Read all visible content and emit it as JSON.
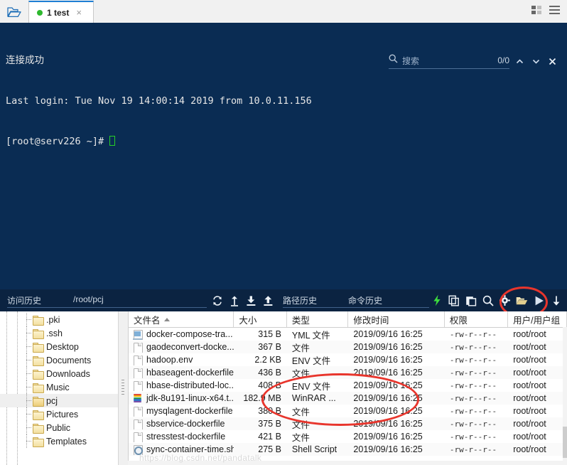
{
  "window": {
    "tab_icon": "folder-open-icon",
    "tabs": [
      {
        "label": "1 test",
        "status_dot": "connected",
        "close": "×"
      }
    ],
    "right_icons": [
      "grid-view-icon",
      "list-view-icon"
    ]
  },
  "terminal": {
    "line1": "连接成功",
    "line2": "Last login: Tue Nov 19 14:00:14 2019 from 10.0.11.156",
    "line3": "[root@serv226 ~]# ",
    "background_color": "#0a2c53",
    "text_color": "#e6e6e6",
    "cursor_color": "#27d027"
  },
  "search": {
    "icon": "search-icon",
    "placeholder": "搜索",
    "value": "",
    "count": "0/0",
    "prev_icon": "chevron-up-icon",
    "next_icon": "chevron-down-icon",
    "close_icon": "close-icon"
  },
  "toolbar": {
    "visit_history_label": "访问历史",
    "path_value": "/root/pcj",
    "path_history_label": "路径历史",
    "command_history_label": "命令历史",
    "left_icons": [
      "refresh-icon",
      "parent-folder-icon",
      "download-icon",
      "upload-icon"
    ],
    "right_icons": [
      "lightning-icon",
      "copy-icon",
      "paste-icon",
      "search-icon",
      "gear-icon",
      "open-folder-icon",
      "run-icon",
      "save-icon",
      "window-icon"
    ],
    "accent_color": "#2eb82e",
    "annotation_color": "#e8352c"
  },
  "tree": {
    "items": [
      {
        "label": ".pki",
        "icon": "folder-icon",
        "selected": false
      },
      {
        "label": ".ssh",
        "icon": "folder-icon",
        "selected": false
      },
      {
        "label": "Desktop",
        "icon": "folder-icon",
        "selected": false
      },
      {
        "label": "Documents",
        "icon": "folder-icon",
        "selected": false
      },
      {
        "label": "Downloads",
        "icon": "folder-icon",
        "selected": false
      },
      {
        "label": "Music",
        "icon": "folder-icon",
        "selected": false
      },
      {
        "label": "pcj",
        "icon": "folder-open-icon",
        "selected": true
      },
      {
        "label": "Pictures",
        "icon": "folder-icon",
        "selected": false
      },
      {
        "label": "Public",
        "icon": "folder-icon",
        "selected": false
      },
      {
        "label": "Templates",
        "icon": "folder-icon",
        "selected": false
      }
    ]
  },
  "filelist": {
    "columns": [
      {
        "label": "文件名",
        "sort": "asc"
      },
      {
        "label": "大小",
        "sort": ""
      },
      {
        "label": "类型",
        "sort": ""
      },
      {
        "label": "修改时间",
        "sort": ""
      },
      {
        "label": "权限",
        "sort": ""
      },
      {
        "label": "用户/用户组",
        "sort": ""
      }
    ],
    "rows": [
      {
        "icon": "yml-file-icon",
        "name": "docker-compose-tra...",
        "size": "315 B",
        "type": "YML 文件",
        "time": "2019/09/16 16:25",
        "perm": "-rw-r--r--",
        "owner": "root/root"
      },
      {
        "icon": "file-icon",
        "name": "gaodeconvert-docke...",
        "size": "367 B",
        "type": "文件",
        "time": "2019/09/16 16:25",
        "perm": "-rw-r--r--",
        "owner": "root/root"
      },
      {
        "icon": "file-icon",
        "name": "hadoop.env",
        "size": "2.2 KB",
        "type": "ENV 文件",
        "time": "2019/09/16 16:25",
        "perm": "-rw-r--r--",
        "owner": "root/root"
      },
      {
        "icon": "file-icon",
        "name": "hbaseagent-dockerfile",
        "size": "436 B",
        "type": "文件",
        "time": "2019/09/16 16:25",
        "perm": "-rw-r--r--",
        "owner": "root/root"
      },
      {
        "icon": "file-icon",
        "name": "hbase-distributed-loc...",
        "size": "408 B",
        "type": "ENV 文件",
        "time": "2019/09/16 16:25",
        "perm": "-rw-r--r--",
        "owner": "root/root"
      },
      {
        "icon": "winrar-file-icon",
        "name": "jdk-8u191-linux-x64.t...",
        "size": "182.9 MB",
        "type": "WinRAR ...",
        "time": "2019/09/16 16:25",
        "perm": "-rw-r--r--",
        "owner": "root/root"
      },
      {
        "icon": "file-icon",
        "name": "mysqlagent-dockerfile",
        "size": "380 B",
        "type": "文件",
        "time": "2019/09/16 16:25",
        "perm": "-rw-r--r--",
        "owner": "root/root"
      },
      {
        "icon": "file-icon",
        "name": "sbservice-dockerfile",
        "size": "375 B",
        "type": "文件",
        "time": "2019/09/16 16:25",
        "perm": "-rw-r--r--",
        "owner": "root/root"
      },
      {
        "icon": "file-icon",
        "name": "stresstest-dockerfile",
        "size": "421 B",
        "type": "文件",
        "time": "2019/09/16 16:25",
        "perm": "-rw-r--r--",
        "owner": "root/root"
      },
      {
        "icon": "shell-file-icon",
        "name": "sync-container-time.sh",
        "size": "275 B",
        "type": "Shell Script",
        "time": "2019/09/16 16:25",
        "perm": "-rw-r--r--",
        "owner": "root/root"
      }
    ]
  },
  "watermark": {
    "text": "https://blog.csdn.net/pandatalk"
  }
}
